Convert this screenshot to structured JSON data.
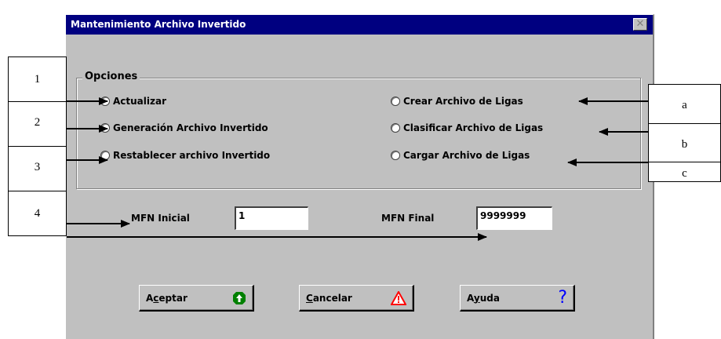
{
  "window": {
    "title": "Mantenimiento Archivo Invertido",
    "close_glyph": "✕"
  },
  "options": {
    "legend": "Opciones",
    "left": [
      "Actualizar",
      "Generación Archivo Invertido",
      "Restablecer archivo Invertido"
    ],
    "right": [
      "Crear Archivo de Ligas",
      "Clasificar Archivo de Ligas",
      "Cargar Archivo de Ligas"
    ]
  },
  "mfn": {
    "initial_label": "MFN Inicial",
    "initial_value": "1",
    "final_label": "MFN Final",
    "final_value": "9999999"
  },
  "buttons": {
    "accept": {
      "prefix": "A",
      "accel": "c",
      "suffix": "eptar"
    },
    "cancel": {
      "prefix": "",
      "accel": "C",
      "suffix": "ancelar"
    },
    "help": {
      "prefix": "A",
      "accel": "y",
      "suffix": "uda"
    }
  },
  "annotations": {
    "numbers": [
      "1",
      "2",
      "3",
      "4"
    ],
    "letters": [
      "a",
      "b",
      "c"
    ]
  },
  "colors": {
    "titlebar": "#000080",
    "dialog": "#c0c0c0",
    "accept_icon": "#008000",
    "cancel_icon": "#ff0000",
    "help_icon": "#0000ff"
  }
}
